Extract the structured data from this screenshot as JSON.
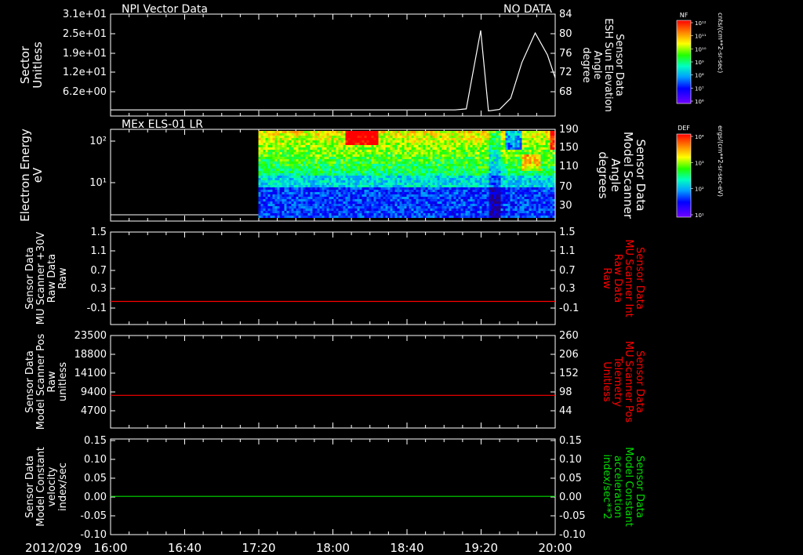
{
  "colors": {
    "background": "#000000",
    "axes": "#ffffff",
    "red": "#ff0000",
    "green": "#00dd00"
  },
  "x_axis": {
    "date_label": "2012/029",
    "tick_labels": [
      "16:00",
      "16:40",
      "17:20",
      "18:00",
      "18:40",
      "19:20",
      "20:00"
    ],
    "x_range_hours": [
      16.0,
      20.0
    ]
  },
  "colorbars": [
    {
      "title": "NF",
      "units": "cnts/(cm**2-sr-sec)",
      "tick_labels": [
        "10¹²",
        "10¹¹",
        "10¹⁰",
        "10⁹",
        "10⁸",
        "10⁷",
        "10⁶"
      ]
    },
    {
      "title": "DEF",
      "units": "ergs/(cm**2-sr-sec-eV)",
      "tick_labels": [
        "10⁴",
        "10³",
        "10²",
        "10¹"
      ]
    }
  ],
  "chart_data": [
    {
      "type": "line",
      "title": "NPI Vector Data",
      "status": "NO DATA",
      "ylabel_left": [
        "Sector",
        "Unitless"
      ],
      "left_ticks": [
        "3.1e+01",
        "2.5e+01",
        "1.9e+01",
        "1.2e+01",
        "6.2e+00"
      ],
      "ylabel_right": [
        "Sensor Data",
        "ESH Sun Elevation",
        "Angle",
        "degree"
      ],
      "right_ticks": [
        "84",
        "80",
        "76",
        "72",
        "68"
      ],
      "ylim": [
        64,
        84
      ],
      "series": [
        {
          "color": "#ffffff",
          "x": [
            16.0,
            18.0,
            18.8,
            19.1,
            19.2,
            19.33,
            19.4,
            19.5,
            19.6,
            19.7,
            19.82,
            19.93,
            20.0
          ],
          "y": [
            65.2,
            65.2,
            65.2,
            65.2,
            65.4,
            80.8,
            65.0,
            65.3,
            67.5,
            74.5,
            80.3,
            76.0,
            71.5
          ]
        }
      ]
    },
    {
      "type": "heatmap",
      "title": "MEx ELS-01 LR",
      "ylabel_left": [
        "Electron Energy",
        "eV"
      ],
      "left_ticks": [
        "10²",
        "10¹"
      ],
      "ylabel_right": [
        "Sensor Data",
        "Model Scanner",
        "Angle",
        "degrees"
      ],
      "right_ticks": [
        "190",
        "150",
        "110",
        "70",
        "30"
      ],
      "data_start_hour": 17.33,
      "colorscale": "DEF"
    },
    {
      "type": "line",
      "ylabel_left": [
        "Sensor Data",
        "MU Scanner +30V",
        "Raw Data",
        "Raw"
      ],
      "left_ticks": [
        "1.5",
        "1.1",
        "0.7",
        "0.3",
        "-0.1"
      ],
      "ylabel_right": [
        "Sensor Data",
        "MU Scanner Int",
        "Raw Data",
        "Raw"
      ],
      "right_ticks": [
        "1.5",
        "1.1",
        "0.7",
        "0.3",
        "-0.1"
      ],
      "ylim": [
        -0.5,
        1.5
      ],
      "series": [
        {
          "color": "#ff0000",
          "x": [
            16.0,
            20.0
          ],
          "y": [
            0.0,
            0.0
          ]
        }
      ]
    },
    {
      "type": "line",
      "ylabel_left": [
        "Sensor Data",
        "Model Scanner Pos",
        "Raw",
        "unitless"
      ],
      "left_ticks": [
        "23500",
        "18800",
        "14100",
        "9400",
        "4700"
      ],
      "ylabel_right": [
        "Sensor Data",
        "MU Scanner Pos",
        "Telemetry",
        "Unitless"
      ],
      "right_ticks": [
        "260",
        "206",
        "152",
        "98",
        "44"
      ],
      "ylim": [
        0,
        23500
      ],
      "series": [
        {
          "color": "#ff0000",
          "x": [
            16.0,
            20.0
          ],
          "y": [
            8300,
            8300
          ]
        }
      ]
    },
    {
      "type": "line",
      "ylabel_left": [
        "Sensor Data",
        "Model Constant",
        "velocity",
        "index/sec"
      ],
      "left_ticks": [
        "0.15",
        "0.10",
        "0.05",
        "0.00",
        "-0.05",
        "-0.10"
      ],
      "ylabel_right": [
        "Sensor Data",
        "Model Constant",
        "acceleration",
        "index/sec**2"
      ],
      "right_ticks": [
        "0.15",
        "0.10",
        "0.05",
        "0.00",
        "-0.05",
        "-0.10"
      ],
      "ylim": [
        -0.1,
        0.15
      ],
      "series": [
        {
          "color": "#00dd00",
          "x": [
            16.0,
            20.0
          ],
          "y": [
            0.0,
            0.0
          ]
        }
      ]
    }
  ]
}
